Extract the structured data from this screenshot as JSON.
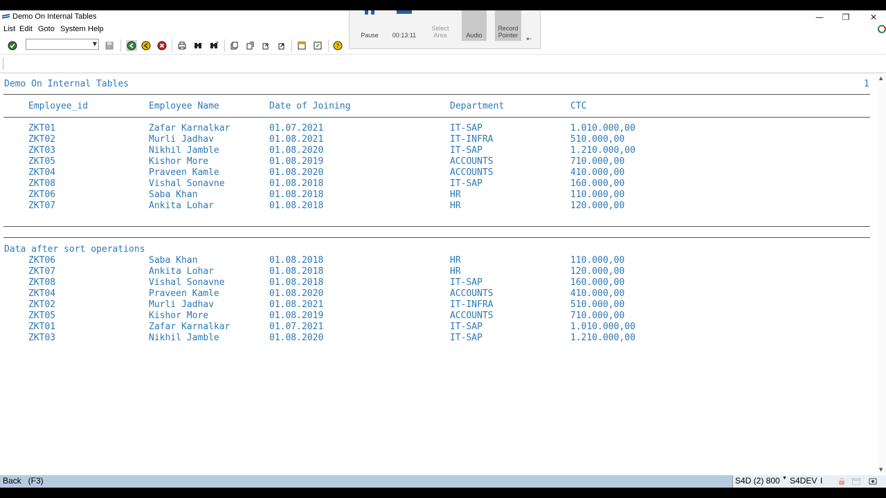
{
  "window": {
    "title": "Demo On Internal Tables",
    "minimize": "—",
    "restore": "❐",
    "close": "✕"
  },
  "menu": [
    "List",
    "Edit",
    "Goto",
    "System",
    "Help"
  ],
  "recorder": {
    "pause": "Pause",
    "timer": "00:13:11",
    "select_area": "Select Area",
    "audio": "Audio",
    "record_pointer": "Record Pointer"
  },
  "report": {
    "title": "Demo On Internal Tables",
    "page_number": "1",
    "columns": [
      "Employee_id",
      "Employee Name",
      "Date of Joining",
      "Department",
      "CTC"
    ],
    "rows": [
      [
        "ZKT01",
        "Zafar Karnalkar",
        "01.07.2021",
        "IT-SAP",
        "1.010.000,00"
      ],
      [
        "ZKT02",
        "Murli Jadhav",
        "01.08.2021",
        "IT-INFRA",
        "510.000,00"
      ],
      [
        "ZKT03",
        "Nikhil Jamble",
        "01.08.2020",
        "IT-SAP",
        "1.210.000,00"
      ],
      [
        "ZKT05",
        "Kishor More",
        "01.08.2019",
        "ACCOUNTS",
        "710.000,00"
      ],
      [
        "ZKT04",
        "Praveen Kamle",
        "01.08.2020",
        "ACCOUNTS",
        "410.000,00"
      ],
      [
        "ZKT08",
        "Vishal Sonavne",
        "01.08.2018",
        "IT-SAP",
        "160.000,00"
      ],
      [
        "ZKT06",
        "Saba Khan",
        "01.08.2018",
        "HR",
        "110.000,00"
      ],
      [
        "ZKT07",
        "Ankita Lohar",
        "01.08.2018",
        "HR",
        "120.000,00"
      ]
    ],
    "sort_heading": "Data after sort operations",
    "sorted_rows": [
      [
        "ZKT06",
        "Saba Khan",
        "01.08.2018",
        "HR",
        "110.000,00"
      ],
      [
        "ZKT07",
        "Ankita Lohar",
        "01.08.2018",
        "HR",
        "120.000,00"
      ],
      [
        "ZKT08",
        "Vishal Sonavne",
        "01.08.2018",
        "IT-SAP",
        "160.000,00"
      ],
      [
        "ZKT04",
        "Praveen Kamle",
        "01.08.2020",
        "ACCOUNTS",
        "410.000,00"
      ],
      [
        "ZKT02",
        "Murli Jadhav",
        "01.08.2021",
        "IT-INFRA",
        "510.000,00"
      ],
      [
        "ZKT05",
        "Kishor More",
        "01.08.2019",
        "ACCOUNTS",
        "710.000,00"
      ],
      [
        "ZKT01",
        "Zafar Karnalkar",
        "01.07.2021",
        "IT-SAP",
        "1.010.000,00"
      ],
      [
        "ZKT03",
        "Nikhil Jamble",
        "01.08.2020",
        "IT-SAP",
        "1.210.000,00"
      ]
    ]
  },
  "status": {
    "message": "Back   (F3)",
    "system": "S4D (2) 800",
    "server": "S4DEV",
    "mode": "I"
  },
  "colors": {
    "list_text": "#2b78b8",
    "status_bar": "#b5cbe0"
  }
}
